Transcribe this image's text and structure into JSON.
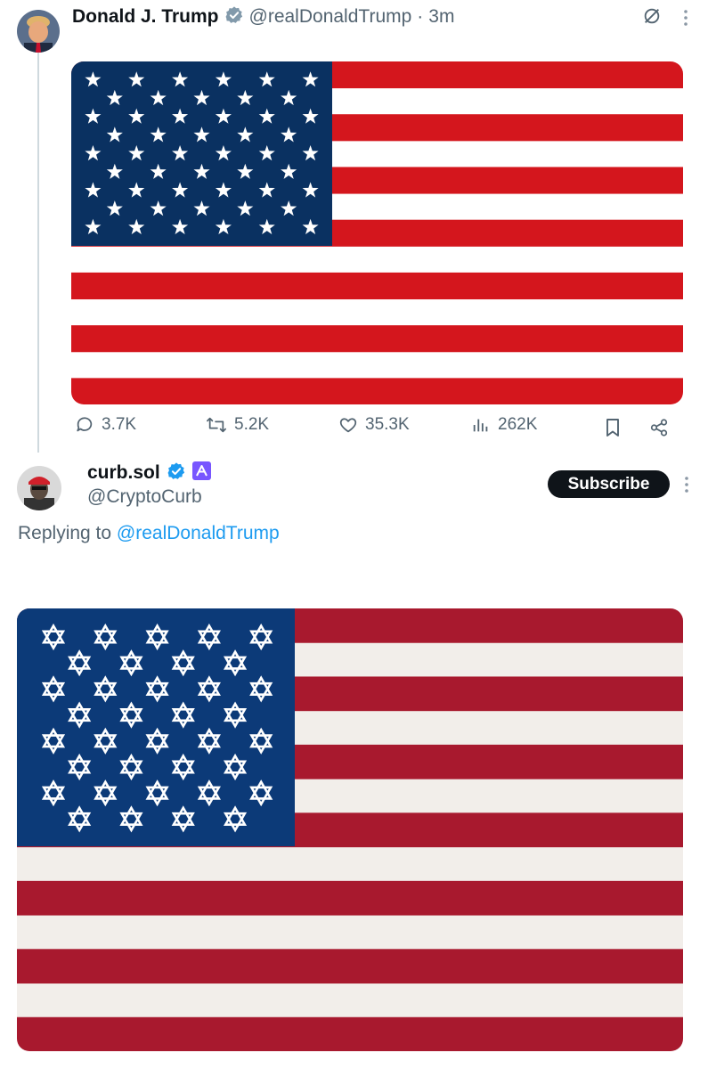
{
  "tweet": {
    "author_name": "Donald J. Trump",
    "handle": "@realDonaldTrump",
    "separator": "·",
    "time": "3m",
    "media_alt": "flag-image",
    "actions": {
      "replies": "3.7K",
      "reposts": "5.2K",
      "likes": "35.3K",
      "views": "262K"
    },
    "icons": [
      "grok-icon",
      "more-icon",
      "reply-icon",
      "repost-icon",
      "like-icon",
      "views-icon",
      "bookmark-icon",
      "share-icon"
    ]
  },
  "reply": {
    "author_name": "curb.sol",
    "handle": "@CryptoCurb",
    "subscribe_label": "Subscribe",
    "replying_prefix": "Replying to",
    "replying_to": "@realDonaldTrump",
    "icons": [
      "verified-badge-icon",
      "premium-icon",
      "more-icon"
    ]
  },
  "colors": {
    "accent": "#1d9bf0",
    "verified_gold_gray": "#829aab",
    "flag_red_top": "#d4161d",
    "flag_blue_top": "#0a3161",
    "flag_red_bottom": "#a8192e",
    "flag_blue_bottom": "#0c3a78"
  }
}
